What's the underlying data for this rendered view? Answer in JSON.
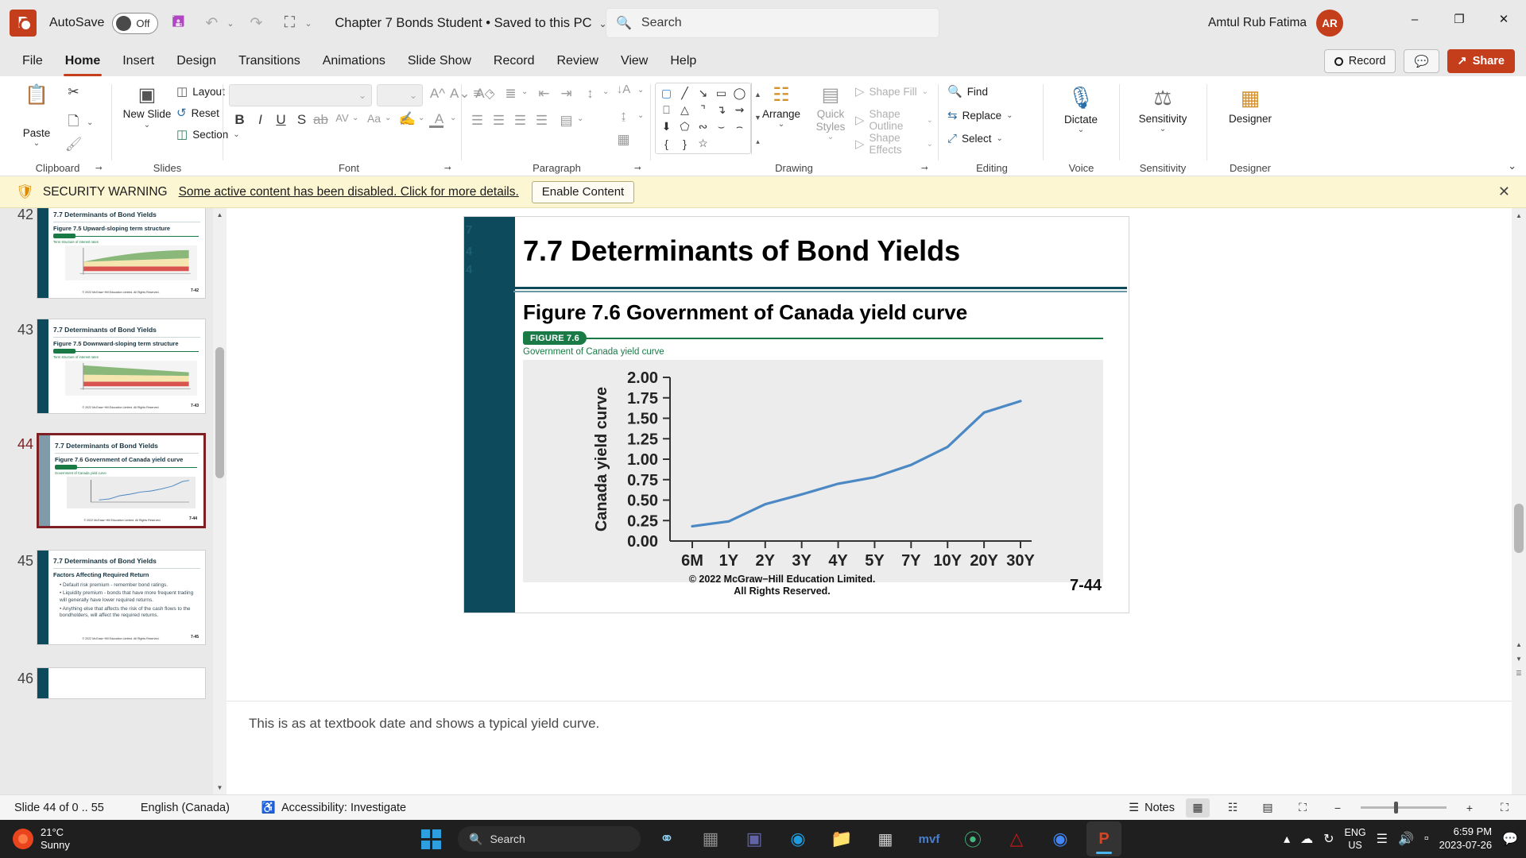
{
  "titlebar": {
    "app_icon": "powerpoint-icon",
    "autosave_label": "AutoSave",
    "autosave_state": "Off",
    "save_icon": "save-icon",
    "undo_icon": "undo-icon",
    "redo_icon": "redo-icon",
    "present_icon": "start-presentation-icon",
    "customize_icon": "customize-quick-access-icon",
    "document_title": "Chapter 7 Bonds Student • Saved to this PC",
    "search_placeholder": "Search",
    "user_name": "Amtul Rub Fatima",
    "user_initials": "AR",
    "minimize": "–",
    "maximize": "❐",
    "close": "✕"
  },
  "tabs": [
    {
      "label": "File",
      "active": false
    },
    {
      "label": "Home",
      "active": true
    },
    {
      "label": "Insert",
      "active": false
    },
    {
      "label": "Design",
      "active": false
    },
    {
      "label": "Transitions",
      "active": false
    },
    {
      "label": "Animations",
      "active": false
    },
    {
      "label": "Slide Show",
      "active": false
    },
    {
      "label": "Record",
      "active": false
    },
    {
      "label": "Review",
      "active": false
    },
    {
      "label": "View",
      "active": false
    },
    {
      "label": "Help",
      "active": false
    }
  ],
  "tab_right": {
    "record_label": "Record",
    "comments_icon": "comment-icon",
    "share_label": "Share"
  },
  "ribbon": {
    "groups": [
      {
        "name": "Clipboard",
        "label": "Clipboard"
      },
      {
        "name": "Slides",
        "label": "Slides"
      },
      {
        "name": "Font",
        "label": "Font"
      },
      {
        "name": "Paragraph",
        "label": "Paragraph"
      },
      {
        "name": "Drawing",
        "label": "Drawing"
      },
      {
        "name": "Editing",
        "label": "Editing"
      },
      {
        "name": "Voice",
        "label": "Voice"
      },
      {
        "name": "Sensitivity",
        "label": "Sensitivity"
      },
      {
        "name": "Designer",
        "label": "Designer"
      }
    ],
    "clipboard": {
      "paste_label": "Paste",
      "cut_icon": "scissors-icon",
      "copy_icon": "copy-icon",
      "format_painter_icon": "format-painter-icon"
    },
    "slides": {
      "new_slide_label": "New Slide",
      "layout_label": "Layout",
      "reset_label": "Reset",
      "section_label": "Section"
    },
    "font": {
      "font_name_value": "",
      "font_size_value": "",
      "bold": "B",
      "italic": "I",
      "underline": "U",
      "shadow": "S",
      "strikethrough": "ab",
      "char_spacing": "AV",
      "change_case": "Aa",
      "grow_font": "A",
      "shrink_font": "A",
      "clear_formatting": "A",
      "highlight_icon": "text-highlight-icon",
      "font_color_icon": "font-color-icon"
    },
    "paragraph": {
      "bullets_icon": "bullets-icon",
      "numbering_icon": "numbering-icon",
      "decrease_indent_icon": "decrease-indent-icon",
      "increase_indent_icon": "increase-indent-icon",
      "line_spacing_icon": "line-spacing-icon",
      "align_left_icon": "align-left-icon",
      "align_center_icon": "align-center-icon",
      "align_right_icon": "align-right-icon",
      "justify_icon": "justify-icon",
      "columns_icon": "columns-icon",
      "text_direction_icon": "text-direction-icon",
      "align_text_icon": "align-text-icon",
      "smartart_icon": "convert-to-smartart-icon"
    },
    "drawing": {
      "shapes": [
        "text-box",
        "line",
        "arrow",
        "rectangle",
        "oval",
        "rounded-rectangle",
        "triangle",
        "elbow-connector",
        "elbow-arrow-connector",
        "right-arrow",
        "down-arrow",
        "pentagon",
        "scribble",
        "curve",
        "arc",
        "left-brace",
        "right-brace",
        "star"
      ],
      "arrange_label": "Arrange",
      "quick_styles_label": "Quick Styles",
      "shape_fill_label": "Shape Fill",
      "shape_outline_label": "Shape Outline",
      "shape_effects_label": "Shape Effects"
    },
    "editing": {
      "find_label": "Find",
      "replace_label": "Replace",
      "select_label": "Select"
    },
    "voice": {
      "dictate_label": "Dictate",
      "icon": "microphone-icon"
    },
    "sensitivity": {
      "label": "Sensitivity",
      "icon": "sensitivity-icon"
    },
    "designer": {
      "label": "Designer",
      "icon": "designer-icon"
    },
    "collapse_icon": "collapse-ribbon-icon"
  },
  "security_bar": {
    "icon": "security-shield-icon",
    "title": "SECURITY WARNING",
    "message": "Some active content has been disabled. Click for more details.",
    "button_label": "Enable Content",
    "close_icon": "close-icon",
    "background": "#fdf6d3"
  },
  "thumbnails": [
    {
      "number": "42",
      "title": "7.7 Determinants of Bond Yields",
      "subtitle": "Figure 7.5 Upward-sloping term structure",
      "caption": "Term structure of interest rates",
      "badge": "FIGURE 7.5",
      "footer": "© 2022 McGraw−Hill Education  Limited. All Rights Reserved.",
      "page": "7-42",
      "selected": false,
      "kind": "figure"
    },
    {
      "number": "43",
      "title": "7.7 Determinants of Bond Yields",
      "subtitle": "Figure 7.5 Downward-sloping term structure",
      "caption": "Term structure of interest rates",
      "badge": "FIGURE 7.5",
      "footer": "© 2022 McGraw−Hill Education  Limited. All Rights Reserved.",
      "page": "7-43",
      "selected": false,
      "kind": "figure"
    },
    {
      "number": "44",
      "title": "7.7 Determinants of Bond Yields",
      "subtitle": "Figure 7.6 Government of Canada yield curve",
      "caption": "Government of Canada yield curve",
      "badge": "FIGURE 7.6",
      "footer": "© 2022 McGraw−Hill Education  Limited. All Rights Reserved.",
      "page": "7-44",
      "selected": true,
      "kind": "chart"
    },
    {
      "number": "45",
      "title": "7.7 Determinants of Bond Yields",
      "subtitle": "Factors Affecting Required Return",
      "bullets": [
        "Default risk premium - remember bond ratings.",
        "Liquidity premium - bonds that have more frequent trading will generally have lower required returns.",
        "Anything else that affects the risk of the cash flows to the bondholders, will affect the required returns."
      ],
      "footer": "© 2022 McGraw−Hill Education  Limited. All Rights Reserved.",
      "page": "7-45",
      "selected": false,
      "kind": "bullets"
    },
    {
      "number": "46",
      "title": "",
      "selected": false,
      "kind": "partial"
    }
  ],
  "slide": {
    "ghost_number": "7 4 4",
    "title": "7.7 Determinants of Bond Yields",
    "subtitle": "Figure 7.6 Government of Canada yield curve",
    "figure_badge": "FIGURE 7.6",
    "figure_caption": "Government of Canada yield curve",
    "copyright_line1": "© 2022 McGraw−Hill Education  Limited.",
    "copyright_line2": "All Rights Reserved.",
    "page_number": "7-44"
  },
  "chart_data": {
    "type": "line",
    "title": "Government of Canada yield curve",
    "xlabel": "",
    "ylabel": "Canada yield curve",
    "categories": [
      "6M",
      "1Y",
      "2Y",
      "3Y",
      "4Y",
      "5Y",
      "7Y",
      "10Y",
      "20Y",
      "30Y"
    ],
    "values": [
      0.18,
      0.24,
      0.45,
      0.57,
      0.7,
      0.78,
      0.93,
      1.15,
      1.57,
      1.71
    ],
    "ylim": [
      0.0,
      2.0
    ],
    "yticks": [
      "0.00",
      "0.25",
      "0.50",
      "0.75",
      "1.00",
      "1.25",
      "1.50",
      "1.75",
      "2.00"
    ],
    "grid": false,
    "legend": "none",
    "line_color": "#4b88c4",
    "plot_background": "#ececec"
  },
  "notes": {
    "text": "This is as at textbook date and shows a typical yield curve."
  },
  "statusbar": {
    "slide_indicator": "Slide 44 of 0 .. 55",
    "language": "English (Canada)",
    "accessibility_icon": "accessibility-icon",
    "accessibility": "Accessibility: Investigate",
    "notes_label": "Notes",
    "notes_icon": "notes-icon",
    "view_normal_icon": "normal-view-icon",
    "view_sorter_icon": "slide-sorter-icon",
    "view_reading_icon": "reading-view-icon",
    "view_slideshow_icon": "slideshow-icon",
    "zoom_out_icon": "zoom-out-icon",
    "zoom_in_icon": "zoom-in-icon",
    "fit_icon": "fit-to-window-icon"
  },
  "taskbar": {
    "weather_temp": "21°C",
    "weather_desc": "Sunny",
    "start_icon": "windows-start-icon",
    "search_placeholder": "Search",
    "apps": [
      {
        "name": "task-view-icon"
      },
      {
        "name": "file-explorer-icon"
      },
      {
        "name": "teams-icon"
      },
      {
        "name": "edge-icon"
      },
      {
        "name": "folder-icon"
      },
      {
        "name": "store-icon"
      },
      {
        "name": "myfiles-icon"
      },
      {
        "name": "copilot-icon"
      },
      {
        "name": "mcafee-icon"
      },
      {
        "name": "chrome-icon"
      },
      {
        "name": "powerpoint-taskbar-icon"
      }
    ],
    "tray": {
      "overflow_icon": "show-hidden-icons-icon",
      "onedrive_icon": "onedrive-icon",
      "update_icon": "windows-update-icon",
      "language_line1": "ENG",
      "language_line2": "US",
      "wifi_icon": "wifi-icon",
      "volume_icon": "volume-icon",
      "battery_icon": "battery-icon",
      "time": "6:59 PM",
      "date": "2023-07-26",
      "notification_icon": "notification-icon"
    }
  }
}
